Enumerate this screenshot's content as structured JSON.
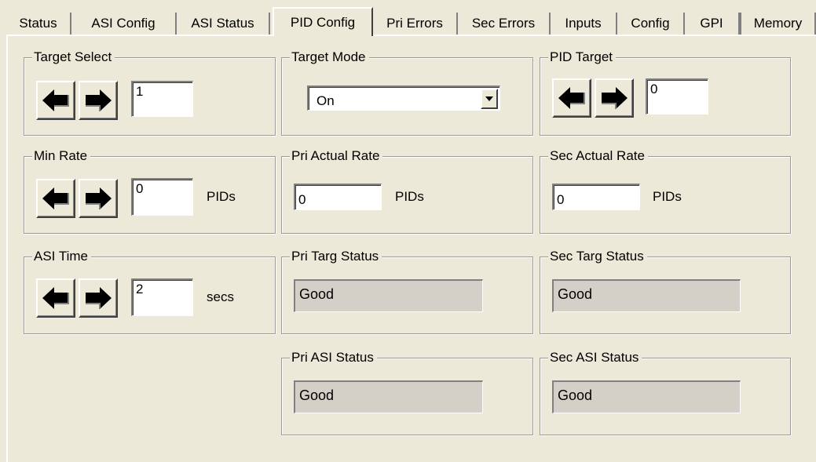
{
  "tabs": [
    {
      "label": "Status",
      "active": false
    },
    {
      "label": "ASI Config",
      "active": false
    },
    {
      "label": "ASI Status",
      "active": false
    },
    {
      "label": "PID Config",
      "active": true
    },
    {
      "label": "Pri Errors",
      "active": false
    },
    {
      "label": "Sec Errors",
      "active": false
    },
    {
      "label": "Inputs",
      "active": false
    },
    {
      "label": "Config",
      "active": false
    },
    {
      "label": "GPI",
      "active": false
    },
    {
      "label": "Memory",
      "active": false
    }
  ],
  "target_select": {
    "title": "Target Select",
    "value": "1"
  },
  "target_mode": {
    "title": "Target Mode",
    "selected": "On"
  },
  "pid_target": {
    "title": "PID Target",
    "value": "0"
  },
  "min_rate": {
    "title": "Min Rate",
    "value": "0",
    "unit": "PIDs"
  },
  "pri_actual_rate": {
    "title": "Pri Actual Rate",
    "value": "0",
    "unit": "PIDs"
  },
  "sec_actual_rate": {
    "title": "Sec Actual Rate",
    "value": "0",
    "unit": "PIDs"
  },
  "asi_time": {
    "title": "ASI Time",
    "value": "2",
    "unit": "secs"
  },
  "pri_targ_status": {
    "title": "Pri Targ Status",
    "value": "Good"
  },
  "sec_targ_status": {
    "title": "Sec Targ Status",
    "value": "Good"
  },
  "pri_asi_status": {
    "title": "Pri ASI Status",
    "value": "Good"
  },
  "sec_asi_status": {
    "title": "Sec ASI Status",
    "value": "Good"
  },
  "icons": {
    "left": "arrow-left-icon",
    "right": "arrow-right-icon",
    "dropdown": "chevron-down-icon"
  }
}
